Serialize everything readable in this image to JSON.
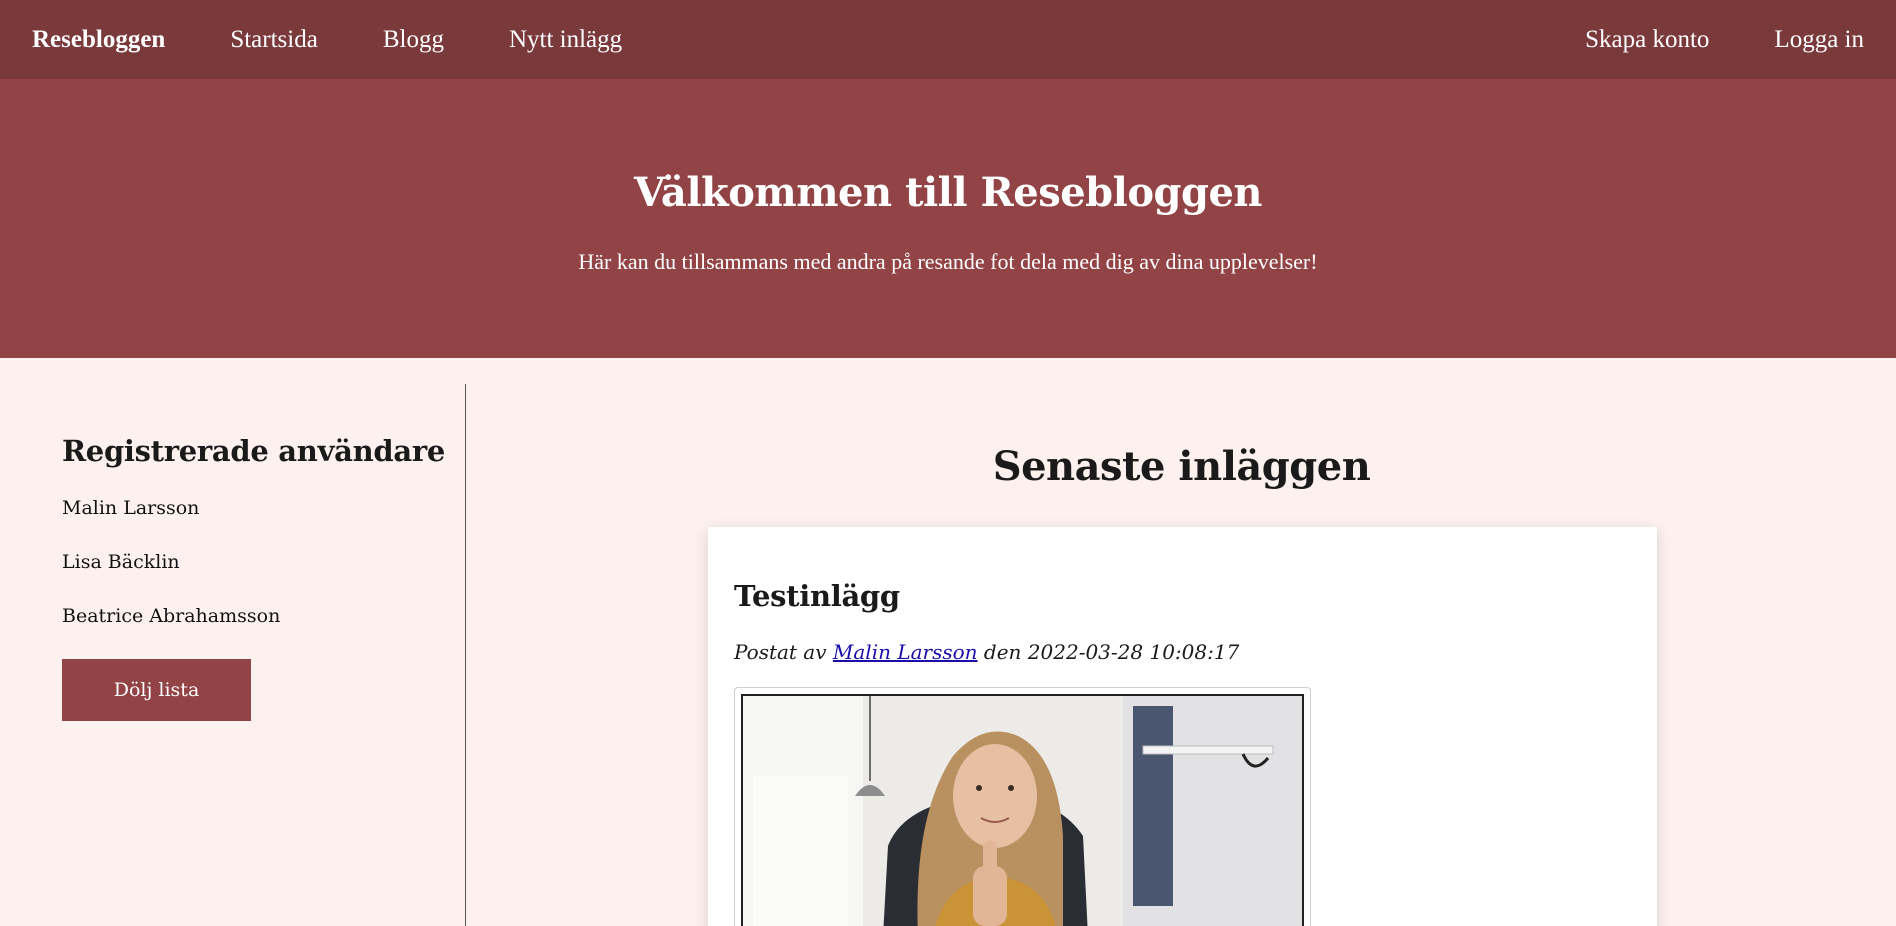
{
  "nav": {
    "brand": "Resebloggen",
    "links": [
      "Startsida",
      "Blogg",
      "Nytt inlägg"
    ],
    "right_links": [
      "Skapa konto",
      "Logga in"
    ]
  },
  "hero": {
    "title": "Välkommen till Resebloggen",
    "subtitle": "Här kan du tillsammans med andra på resande fot dela med dig av dina upplevelser!"
  },
  "sidebar": {
    "title": "Registrerade användare",
    "users": [
      "Malin Larsson",
      "Lisa Bäcklin",
      "Beatrice Abrahamsson"
    ],
    "hide_button": "Dölj lista"
  },
  "main": {
    "title": "Senaste inläggen",
    "post": {
      "title": "Testinlägg",
      "meta_prefix": "Postat av",
      "author": "Malin Larsson",
      "meta_middle": "den",
      "date": "2022-03-28 10:08:17"
    }
  },
  "colors": {
    "nav_bg": "#7a393a",
    "hero_bg": "#914345",
    "page_bg": "#fdf1f0",
    "button_bg": "#914345"
  }
}
